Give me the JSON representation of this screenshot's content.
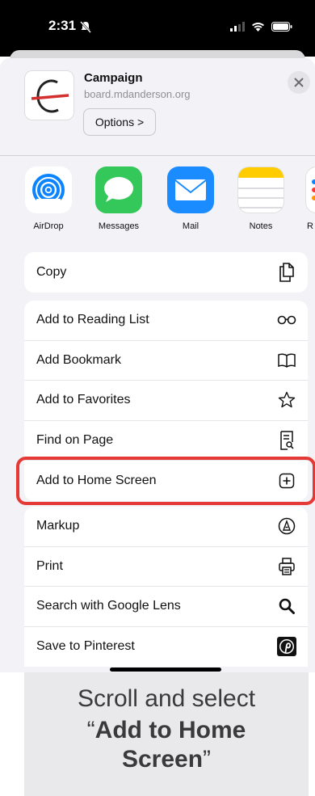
{
  "status_bar": {
    "time": "2:31"
  },
  "share_sheet": {
    "site_title": "Campaign",
    "site_url": "board.mdanderson.org",
    "options_label": "Options >",
    "apps": [
      {
        "label": "AirDrop",
        "icon": "airdrop-icon"
      },
      {
        "label": "Messages",
        "icon": "messages-icon"
      },
      {
        "label": "Mail",
        "icon": "mail-icon"
      },
      {
        "label": "Notes",
        "icon": "notes-icon"
      },
      {
        "label": "R",
        "icon": "reminders-icon"
      }
    ],
    "actions_group1": [
      {
        "label": "Copy",
        "icon": "copy-icon"
      }
    ],
    "actions_group2": [
      {
        "label": "Add to Reading List",
        "icon": "glasses-icon"
      },
      {
        "label": "Add Bookmark",
        "icon": "book-icon"
      },
      {
        "label": "Add to Favorites",
        "icon": "star-icon"
      },
      {
        "label": "Find on Page",
        "icon": "find-icon"
      },
      {
        "label": "Add to Home Screen",
        "icon": "plus-square-icon"
      }
    ],
    "actions_group3": [
      {
        "label": "Markup",
        "icon": "markup-icon"
      },
      {
        "label": "Print",
        "icon": "printer-icon"
      },
      {
        "label": "Search with Google Lens",
        "icon": "search-icon"
      },
      {
        "label": "Save to Pinterest",
        "icon": "pinterest-icon"
      }
    ]
  },
  "caption": {
    "line1": "Scroll and select",
    "line2_open": "“",
    "line2_bold": "Add to Home Screen",
    "line2_close": "”"
  },
  "colors": {
    "highlight": "#e53935",
    "sheet_background": "#f2f2f7",
    "messages_green": "#34c759",
    "mail_blue": "#1a8cff",
    "airdrop_blue": "#0a84ff"
  }
}
